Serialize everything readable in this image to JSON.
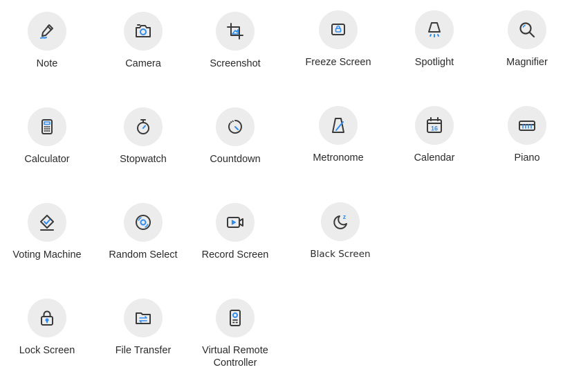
{
  "colors": {
    "icon_stroke": "#3a3a3a",
    "accent": "#2f8cf0",
    "circle_bg": "#ececec",
    "label": "#2b2b2b"
  },
  "tools": [
    {
      "label": "Note",
      "icon": "pen-icon"
    },
    {
      "label": "Camera",
      "icon": "camera-icon"
    },
    {
      "label": "Screenshot",
      "icon": "crop-icon"
    },
    {
      "label": "Freeze Screen",
      "icon": "freeze-icon"
    },
    {
      "label": "Spotlight",
      "icon": "spotlight-icon"
    },
    {
      "label": "Magnifier",
      "icon": "magnifier-icon"
    },
    {
      "label": "Calculator",
      "icon": "calculator-icon"
    },
    {
      "label": "Stopwatch",
      "icon": "stopwatch-icon"
    },
    {
      "label": "Countdown",
      "icon": "countdown-icon"
    },
    {
      "label": "Metronome",
      "icon": "metronome-icon"
    },
    {
      "label": "Calendar",
      "icon": "calendar-icon",
      "icon_text": "16"
    },
    {
      "label": "Piano",
      "icon": "piano-icon"
    },
    {
      "label": "Voting Machine",
      "icon": "voting-icon"
    },
    {
      "label": "Random Select",
      "icon": "random-select-icon"
    },
    {
      "label": "Record Screen",
      "icon": "record-screen-icon"
    },
    {
      "label": "Black Screen",
      "icon": "moon-icon",
      "icon_text": "z"
    },
    {
      "label": "Lock Screen",
      "icon": "lock-icon"
    },
    {
      "label": "File Transfer",
      "icon": "file-transfer-icon"
    },
    {
      "label": "Virtual Remote\nController",
      "icon": "remote-controller-icon"
    }
  ]
}
